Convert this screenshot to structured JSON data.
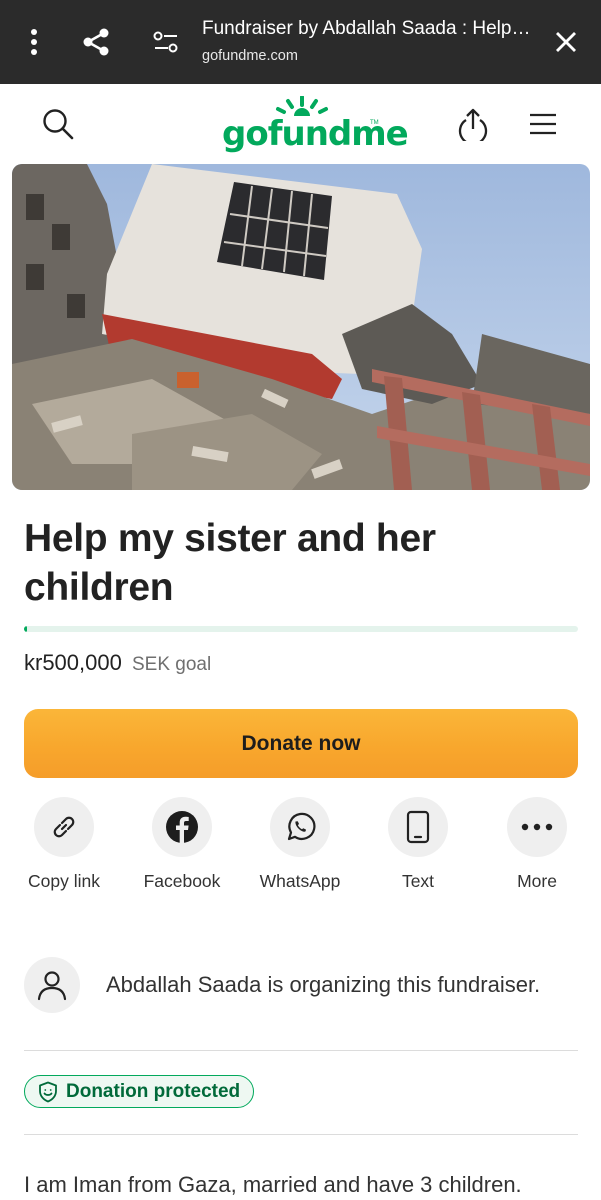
{
  "browser": {
    "title": "Fundraiser by Abdallah Saada : Help my sister and her children",
    "url": "gofundme.com",
    "icons": [
      "more-vertical-icon",
      "share-icon",
      "page-settings-icon",
      "close-icon"
    ]
  },
  "site": {
    "logo": "gofundme",
    "logo_tm": "TM",
    "icons": [
      "search-icon",
      "upload-share-icon",
      "menu-icon"
    ]
  },
  "colors": {
    "brand_green": "#02a95c",
    "donate_orange": "#f8a72d",
    "topbar_bg": "#2b2b2b"
  },
  "campaign": {
    "title": "Help my sister and her children",
    "progress_fraction": 0.005,
    "goal_amount": "kr500,000",
    "goal_label": "SEK goal"
  },
  "donate_button": {
    "label": "Donate now"
  },
  "share_options": [
    {
      "label": "Copy link",
      "icon": "link-icon"
    },
    {
      "label": "Facebook",
      "icon": "facebook-icon"
    },
    {
      "label": "WhatsApp",
      "icon": "whatsapp-icon"
    },
    {
      "label": "Text",
      "icon": "phone-icon"
    },
    {
      "label": "More",
      "icon": "more-horizontal-icon"
    }
  ],
  "organizer": {
    "text": "Abdallah Saada is organizing this fundraiser."
  },
  "protection_badge": {
    "label": "Donation protected"
  },
  "story": {
    "first_line": "I am Iman from Gaza, married and have 3 children."
  }
}
